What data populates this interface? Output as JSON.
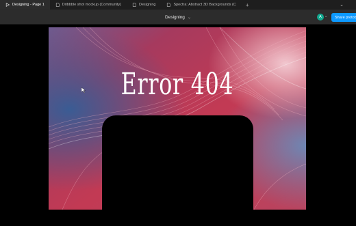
{
  "tabs": [
    {
      "label": "Designing - Page 1",
      "active": true,
      "icon": "play-icon"
    },
    {
      "label": "Dribbble shot mockup (Community)",
      "active": false,
      "icon": "file-icon"
    },
    {
      "label": "Designing",
      "active": false,
      "icon": "file-icon"
    },
    {
      "label": "Spectra: Abstract 3D Backgrounds (C",
      "active": false,
      "icon": "file-icon"
    }
  ],
  "toolbar": {
    "file_title": "Designing",
    "avatar_initial": "A",
    "share_label": "Share prototype"
  },
  "canvas": {
    "heading": "Error 404"
  },
  "colors": {
    "share": "#0d99ff",
    "avatar": "#12a88f",
    "bg_red": "#c8354f",
    "bg_blue": "#3f5f93"
  }
}
